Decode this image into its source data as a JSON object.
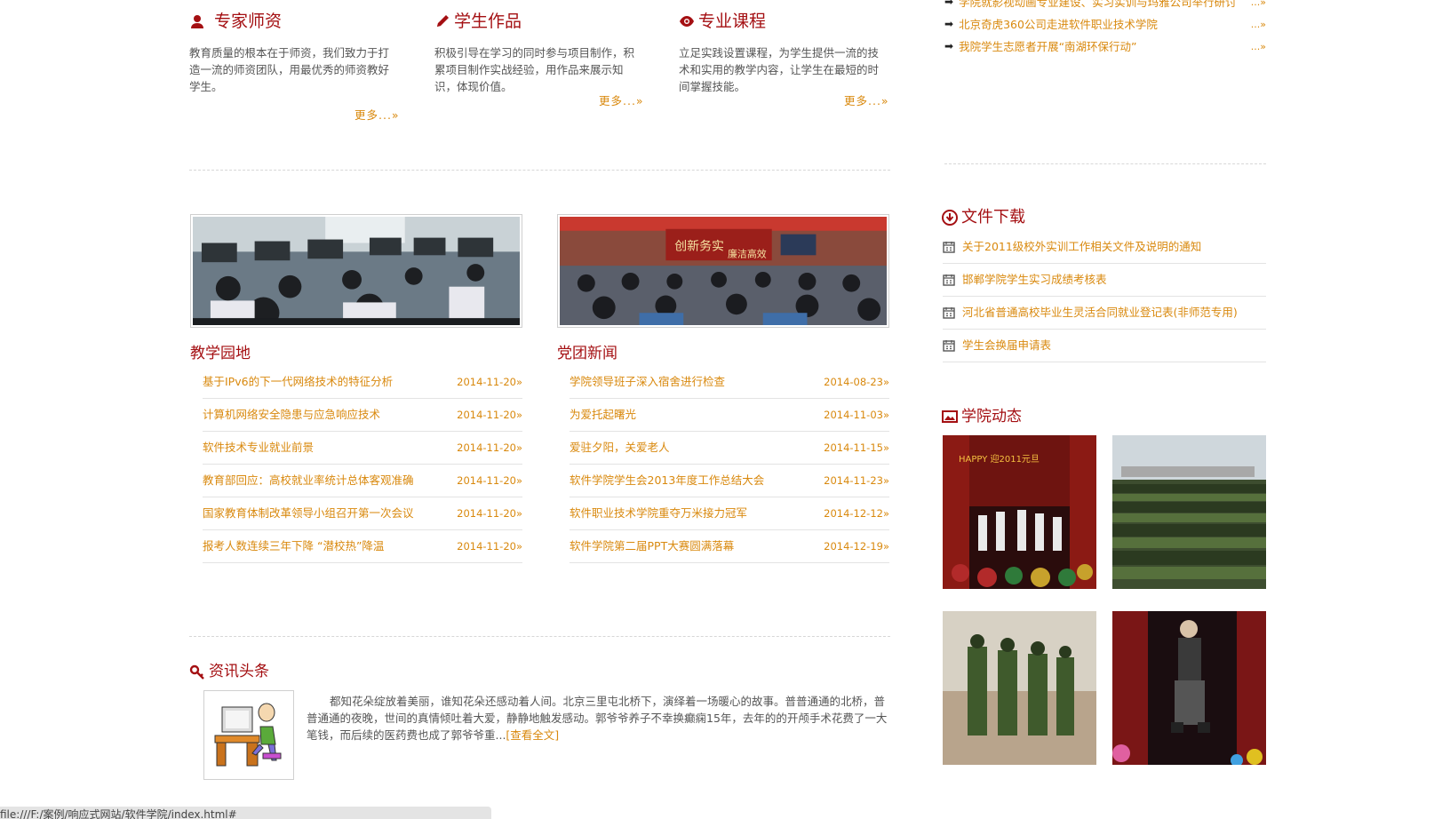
{
  "features": [
    {
      "title": "专家师资",
      "icon": "user-icon",
      "text": "教育质量的根本在于师资，我们致力于打造一流的师资团队，用最优秀的师资教好学生。",
      "more": "更多...»"
    },
    {
      "title": "学生作品",
      "icon": "pencil-icon",
      "text": "积极引导在学习的同时参与项目制作，积累项目制作实战经验，用作品来展示知识，体现价值。",
      "more": "更多...»"
    },
    {
      "title": "专业课程",
      "icon": "eye-icon",
      "text": "立足实践设置课程，为学生提供一流的技术和实用的教学内容，让学生在最短的时间掌握技能。",
      "more": "更多...»"
    }
  ],
  "top_news": {
    "items": [
      {
        "text": "学院就影视动画专业建设、实习实训与玛雅公司举行研讨",
        "more": "...»"
      },
      {
        "text": "北京奇虎360公司走进软件职业技术学院",
        "more": "...»"
      },
      {
        "text": "我院学生志愿者开展“南湖环保行动”",
        "more": "...»"
      }
    ]
  },
  "teaching": {
    "title": "教学园地",
    "items": [
      {
        "title": "基于IPv6的下一代网络技术的特征分析",
        "date": "2014-11-20»"
      },
      {
        "title": "计算机网络安全隐患与应急响应技术",
        "date": "2014-11-20»"
      },
      {
        "title": "软件技术专业就业前景",
        "date": "2014-11-20»"
      },
      {
        "title": "教育部回应：高校就业率统计总体客观准确",
        "date": "2014-11-20»"
      },
      {
        "title": "国家教育体制改革领导小组召开第一次会议",
        "date": "2014-11-20»"
      },
      {
        "title": "报考人数连续三年下降 “潜校热”降温",
        "date": "2014-11-20»"
      }
    ]
  },
  "party": {
    "title": "党团新闻",
    "banner_text_1": "创新务实",
    "banner_text_2": "廉洁高效",
    "items": [
      {
        "title": "学院领导班子深入宿舍进行检查",
        "date": "2014-08-23»"
      },
      {
        "title": "为爱托起曙光",
        "date": "2014-11-03»"
      },
      {
        "title": "爱驻夕阳，关爱老人",
        "date": "2014-11-15»"
      },
      {
        "title": "软件学院学生会2013年度工作总结大会",
        "date": "2014-11-23»"
      },
      {
        "title": "软件职业技术学院重夺万米接力冠军",
        "date": "2014-12-12»"
      },
      {
        "title": "软件学院第二届PPT大赛圆满落幕",
        "date": "2014-12-19»"
      }
    ]
  },
  "downloads": {
    "title": "文件下载",
    "items": [
      "关于2011级校外实训工作相关文件及说明的通知",
      "邯郸学院学生实习成绩考核表",
      "河北省普通高校毕业生灵活合同就业登记表(非师范专用)",
      "学生会换届申请表"
    ]
  },
  "headline": {
    "title": "资讯头条",
    "text": "都知花朵绽放着美丽，谁知花朵还感动着人间。北京三里屯北桥下，演绎着一场暖心的故事。普普通通的北桥，普普通通的夜晚，世间的真情倾吐着大爱，静静地触发感动。郭爷爷养子不幸换癫痫15年，去年的的开颅手术花费了一大笔钱，而后续的医药费也成了郭爷爷重...",
    "link": "[查看全文]"
  },
  "campus": {
    "title": "学院动态",
    "photo1_text": "HAPPY 迎2011元旦"
  },
  "status_bar": {
    "url": "file:///F:/案例/响应式网站/软件学院/index.html#"
  },
  "colors": {
    "heading": "#a40f12",
    "link": "#d9890e",
    "body_text": "#555555"
  }
}
